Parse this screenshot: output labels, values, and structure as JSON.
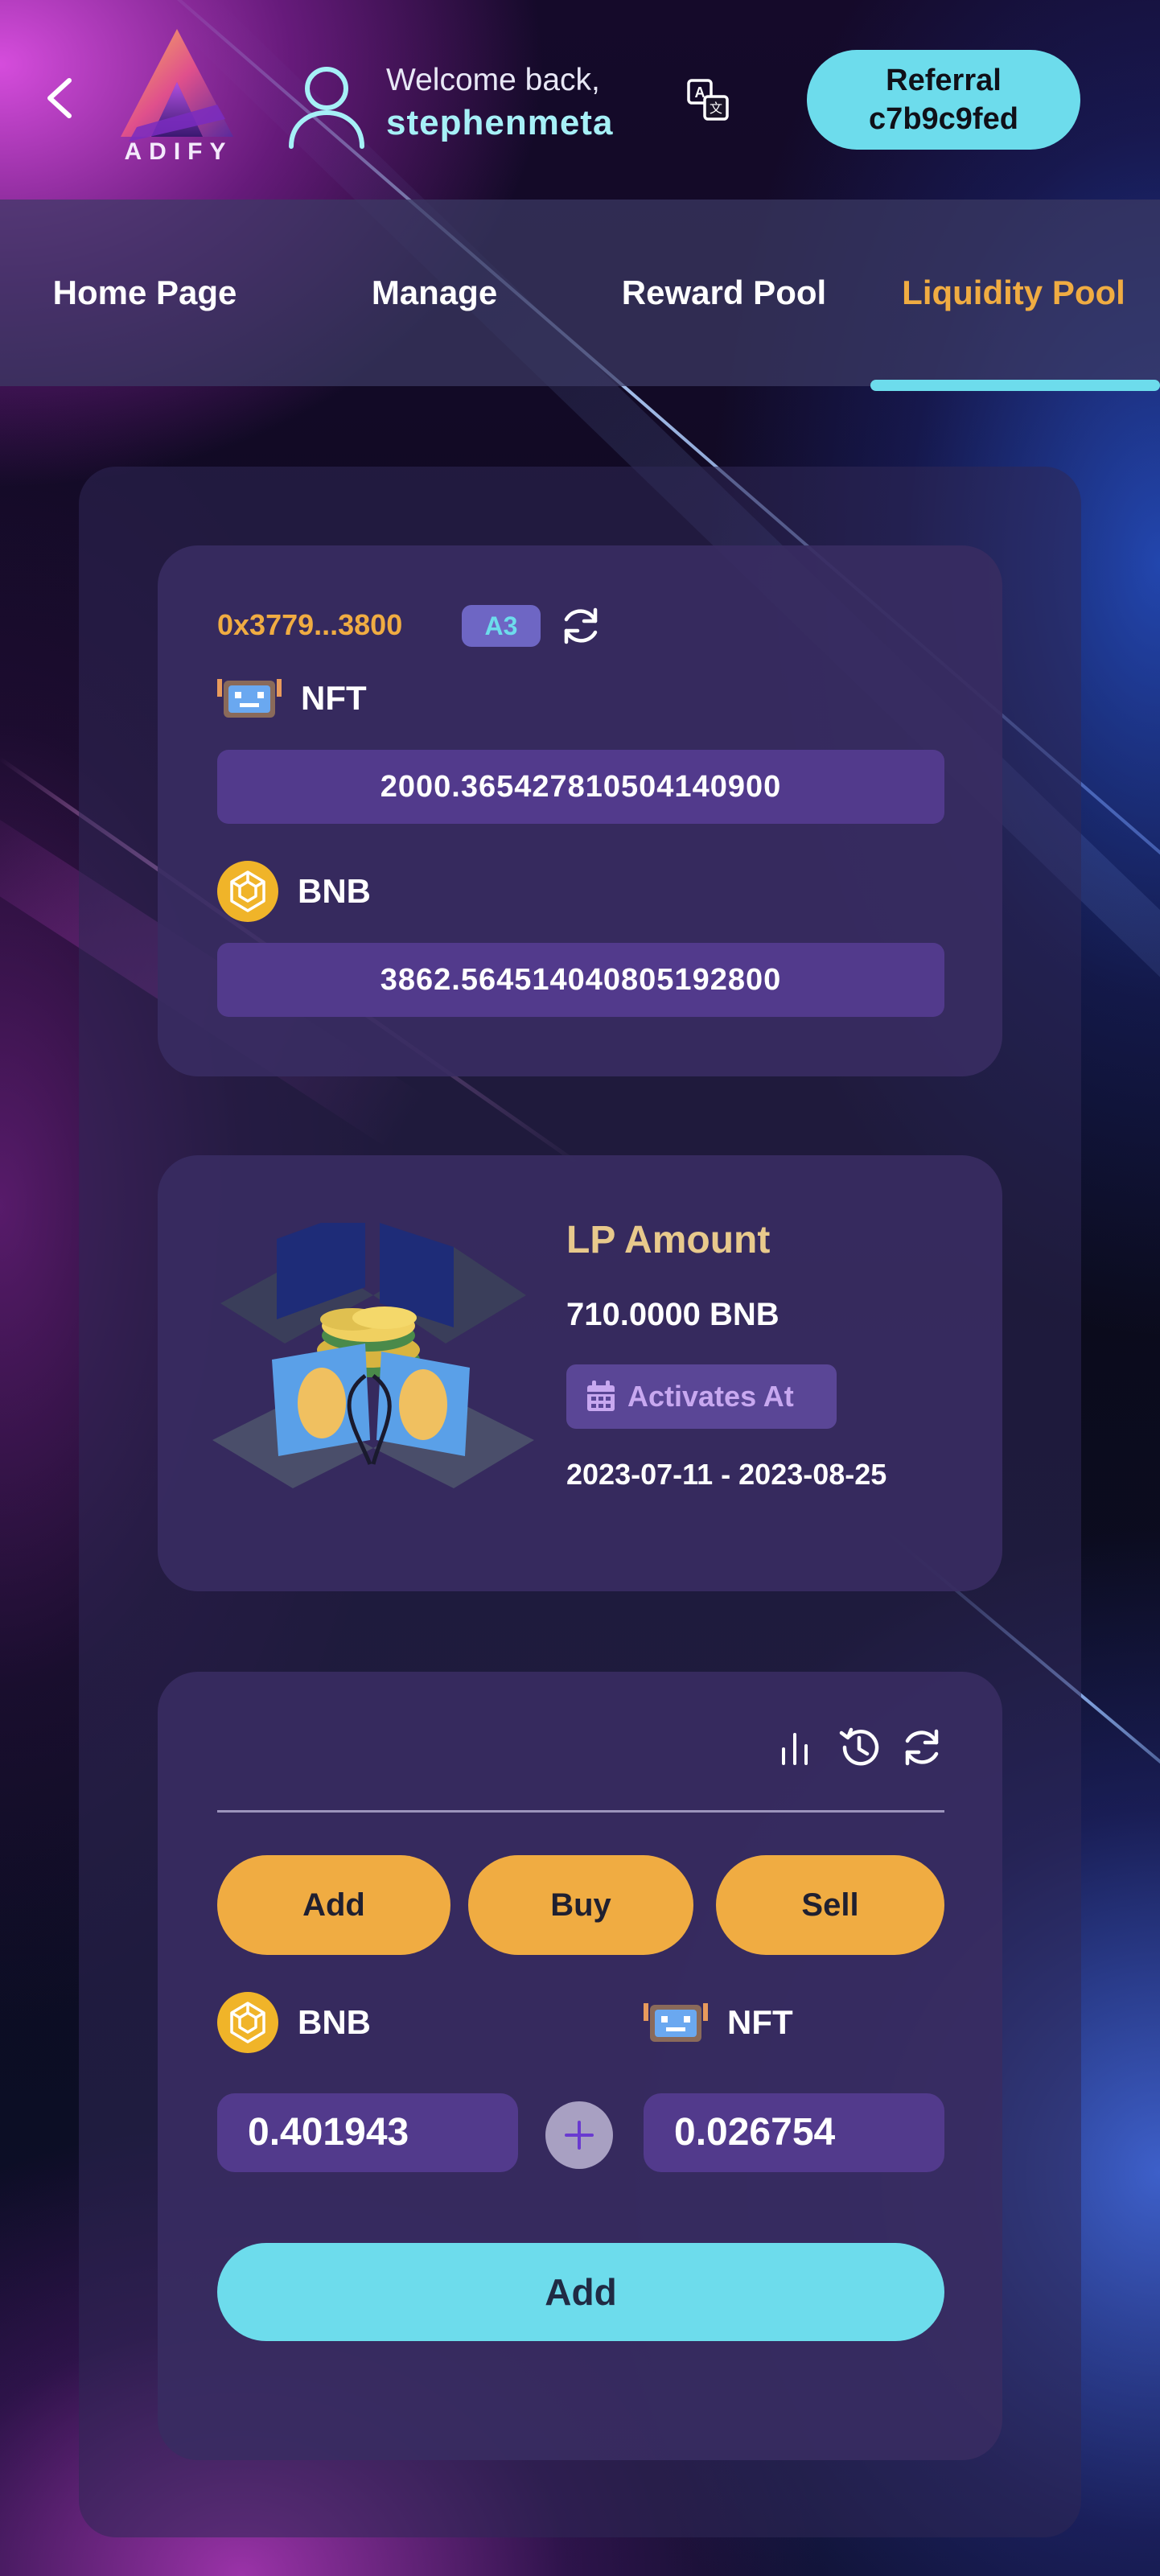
{
  "header": {
    "logo_text": "ADIFY",
    "welcome": "Welcome back,",
    "username": "stephenmeta",
    "referral_label": "Referral",
    "referral_code": "c7b9c9fed"
  },
  "tabs": [
    {
      "label": "Home Page",
      "active": false
    },
    {
      "label": "Manage",
      "active": false
    },
    {
      "label": "Reward Pool",
      "active": false
    },
    {
      "label": "Liquidity Pool",
      "active": true
    }
  ],
  "pool_card": {
    "address": "0x3779...3800",
    "badge": "A3",
    "tokens": [
      {
        "name": "NFT",
        "icon": "nft-robot-icon",
        "value": "2000.365427810504140900"
      },
      {
        "name": "BNB",
        "icon": "bnb-coin-icon",
        "value": "3862.564514040805192800"
      }
    ]
  },
  "lp_card": {
    "title": "LP Amount",
    "amount": "710.0000 BNB",
    "activates_label": "Activates At",
    "dates": "2023-07-11 - 2023-08-25"
  },
  "trade_card": {
    "actions": [
      "Add",
      "Buy",
      "Sell"
    ],
    "left_token": "BNB",
    "right_token": "NFT",
    "left_value": "0.401943",
    "right_value": "0.026754",
    "submit_label": "Add"
  },
  "colors": {
    "accent_orange": "#f0ac42",
    "accent_cyan": "#6ddcec",
    "card_bg": "#382c62",
    "field_bg": "#523a8c"
  }
}
